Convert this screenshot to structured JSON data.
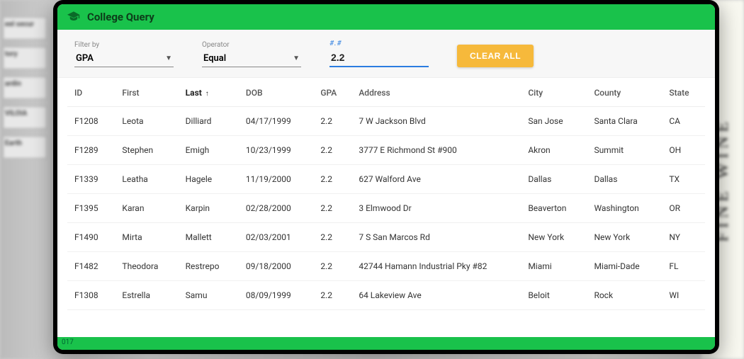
{
  "header": {
    "title": "College Query"
  },
  "filter": {
    "filterby_label": "Filter by",
    "filterby_value": "GPA",
    "operator_label": "Operator",
    "operator_value": "Equal",
    "value_hint": "#.#",
    "value": "2.2",
    "clear_label": "CLEAR ALL"
  },
  "table": {
    "columns": [
      "ID",
      "First",
      "Last",
      "DOB",
      "GPA",
      "Address",
      "City",
      "County",
      "State"
    ],
    "sort_column": "Last",
    "sort_dir": "asc",
    "rows": [
      {
        "id": "F1208",
        "first": "Leota",
        "last": "Dilliard",
        "dob": "04/17/1999",
        "gpa": "2.2",
        "address": "7 W Jackson Blvd",
        "city": "San Jose",
        "county": "Santa Clara",
        "state": "CA"
      },
      {
        "id": "F1289",
        "first": "Stephen",
        "last": "Emigh",
        "dob": "10/23/1999",
        "gpa": "2.2",
        "address": "3777 E Richmond St #900",
        "city": "Akron",
        "county": "Summit",
        "state": "OH"
      },
      {
        "id": "F1339",
        "first": "Leatha",
        "last": "Hagele",
        "dob": "11/19/2000",
        "gpa": "2.2",
        "address": "627 Walford Ave",
        "city": "Dallas",
        "county": "Dallas",
        "state": "TX"
      },
      {
        "id": "F1395",
        "first": "Karan",
        "last": "Karpin",
        "dob": "02/28/2000",
        "gpa": "2.2",
        "address": "3 Elmwood Dr",
        "city": "Beaverton",
        "county": "Washington",
        "state": "OR"
      },
      {
        "id": "F1490",
        "first": "Mirta",
        "last": "Mallett",
        "dob": "02/03/2001",
        "gpa": "2.2",
        "address": "7 S San Marcos Rd",
        "city": "New York",
        "county": "New York",
        "state": "NY"
      },
      {
        "id": "F1482",
        "first": "Theodora",
        "last": "Restrepo",
        "dob": "09/18/2000",
        "gpa": "2.2",
        "address": "42744 Hamann Industrial Pky #82",
        "city": "Miami",
        "county": "Miami-Dade",
        "state": "FL"
      },
      {
        "id": "F1308",
        "first": "Estrella",
        "last": "Samu",
        "dob": "08/09/1999",
        "gpa": "2.2",
        "address": "64 Lakeview Ave",
        "city": "Beloit",
        "county": "Rock",
        "state": "WI"
      }
    ]
  },
  "footer": {
    "text": "017"
  },
  "bg": {
    "left": [
      "eel secur",
      "tory",
      "ardin",
      "VILOIA",
      "Earth"
    ],
    "right": "FINE WINE"
  }
}
